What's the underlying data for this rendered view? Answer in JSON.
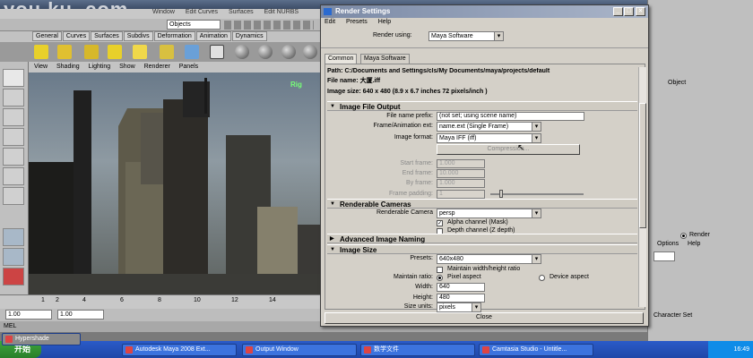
{
  "watermark": "you ku .com",
  "maya": {
    "menus": [
      "Window",
      "Edit Curves",
      "Surfaces",
      "Edit NURBS"
    ],
    "objects_field": "Objects",
    "shelf_tabs": [
      "General",
      "Curves",
      "Surfaces",
      "Subdivs",
      "Deformation",
      "Animation",
      "Dynamics"
    ],
    "panel_menus": [
      "View",
      "Shading",
      "Lighting",
      "Show",
      "Renderer",
      "Panels"
    ],
    "viewport_label": "Rig",
    "timeline_ticks": [
      "1",
      "2",
      "4",
      "6",
      "8",
      "10",
      "12",
      "14"
    ],
    "range_start": "1.00",
    "range_start2": "1.00",
    "mel_label": "MEL",
    "right_panel": {
      "object_label": "Object",
      "render_radio": "Render",
      "options_label": "Options",
      "help_label": "Help",
      "character_set_label": "Character Set"
    }
  },
  "taskbar": {
    "start": "开始",
    "tasks": [
      "Hypershade",
      "Autodesk Maya 2008 Ext...",
      "Output Window",
      "数学文件",
      "Camtasia Studio - Untitle..."
    ],
    "clock": "16:49"
  },
  "dialog": {
    "title": "Render Settings",
    "menus": [
      "Edit",
      "Presets",
      "Help"
    ],
    "render_using_label": "Render using:",
    "render_using_value": "Maya Software",
    "tabs": [
      "Common",
      "Maya Software"
    ],
    "path_line": "Path: C:/Documents and Settings/cls/My Documents/maya/projects/default",
    "file_name_line": "File name: 大厦.iff",
    "image_size_line": "Image size: 640 x 480 (8.9 x 6.7 inches 72 pixels/inch )",
    "sections": {
      "image_file_output": "Image File Output",
      "renderable_cameras": "Renderable Cameras",
      "advanced_image_naming": "Advanced Image Naming",
      "image_size": "Image Size"
    },
    "file_prefix_label": "File name prefix:",
    "file_prefix_value": "(not set; using scene name)",
    "frame_ext_label": "Frame/Animation ext:",
    "frame_ext_value": "name.ext (Single Frame)",
    "image_format_label": "Image format:",
    "image_format_value": "Maya IFF (iff)",
    "compression_label": "Compression...",
    "start_frame_label": "Start frame:",
    "start_frame_value": "1.000",
    "end_frame_label": "End frame:",
    "end_frame_value": "10.000",
    "by_frame_label": "By frame:",
    "by_frame_value": "1.000",
    "frame_padding_label": "Frame padding:",
    "frame_padding_value": "1",
    "renderable_camera_label": "Renderable Camera",
    "renderable_camera_value": "persp",
    "alpha_label": "Alpha channel (Mask)",
    "depth_label": "Depth channel (Z depth)",
    "presets_label": "Presets:",
    "presets_value": "640x480",
    "maintain_wh_label": "Maintain width/height ratio",
    "maintain_ratio_label": "Maintain ratio:",
    "pixel_aspect_label": "Pixel aspect",
    "device_aspect_label": "Device aspect",
    "width_label": "Width:",
    "width_value": "640",
    "height_label": "Height:",
    "height_value": "480",
    "size_units_label": "Size units:",
    "size_units_value": "pixels",
    "close_label": "Close"
  }
}
